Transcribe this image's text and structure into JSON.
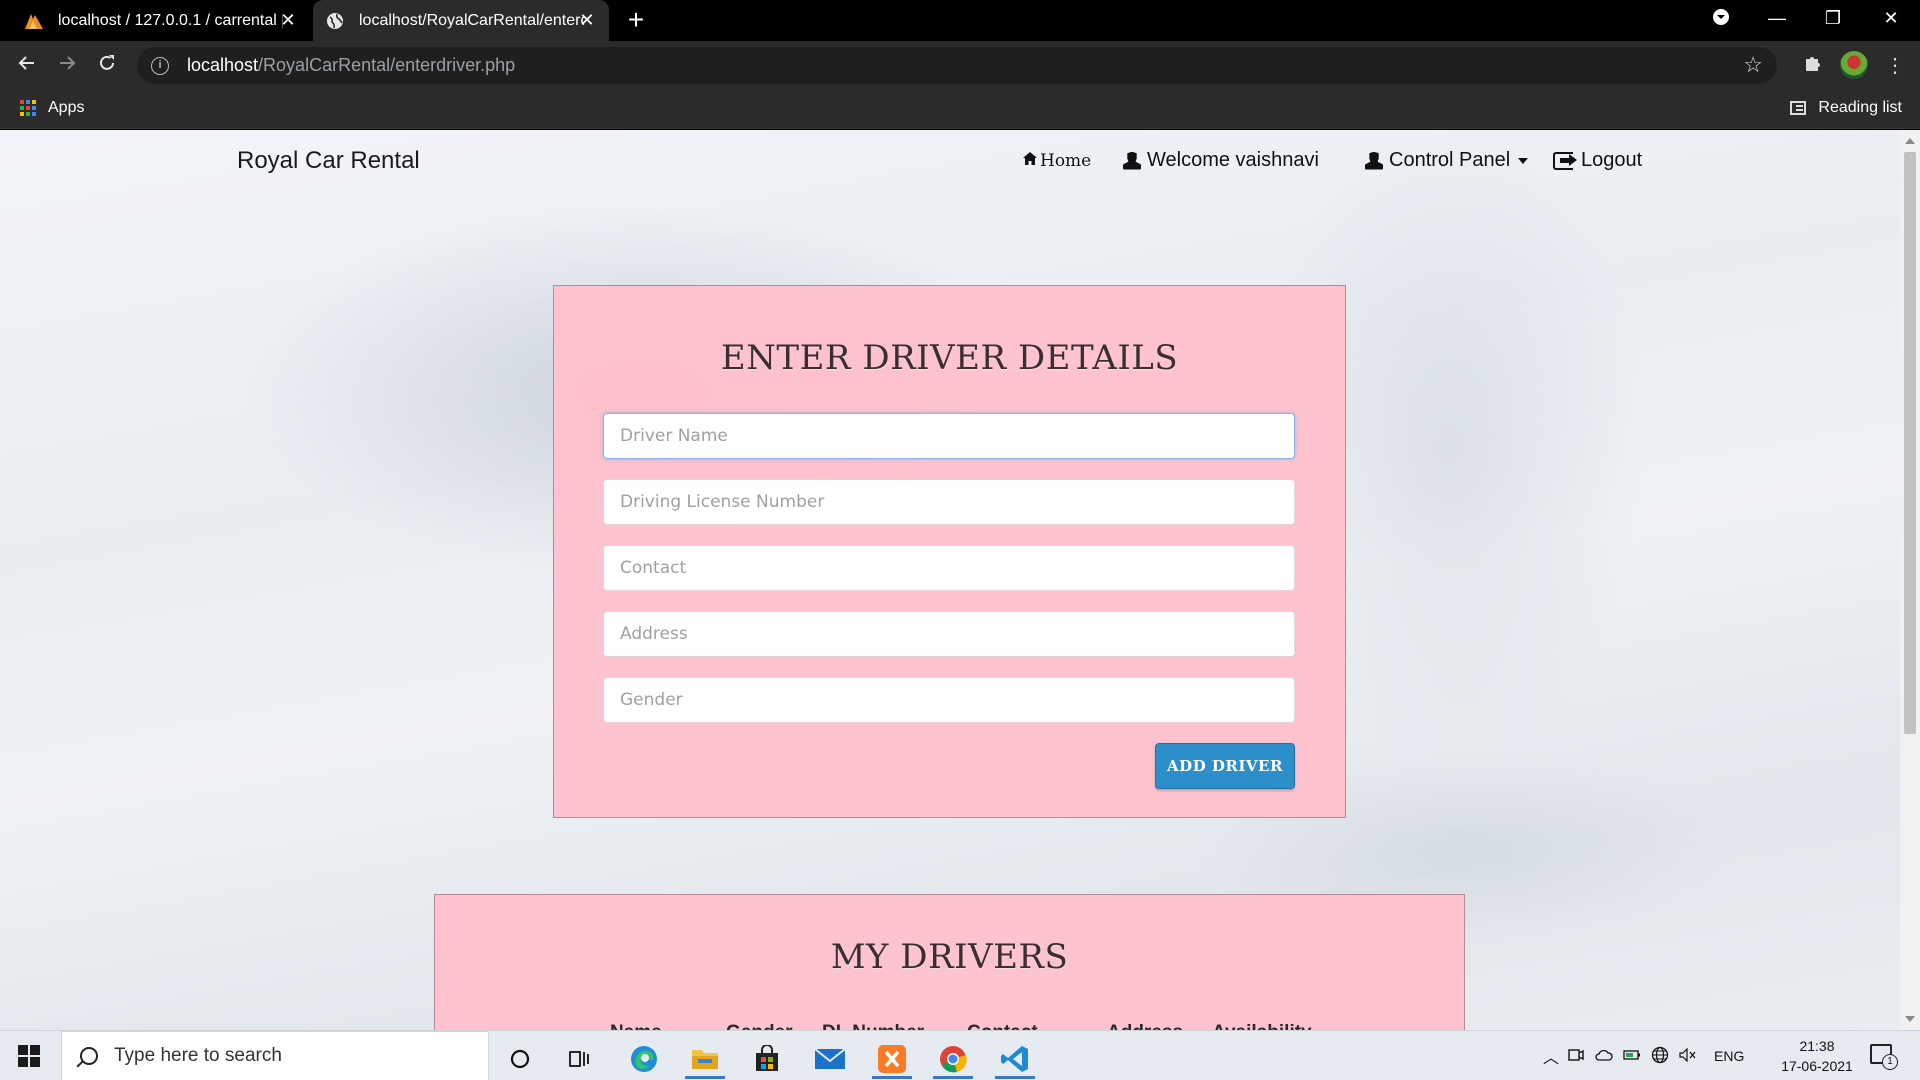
{
  "browser": {
    "tabs": [
      {
        "title": "localhost / 127.0.0.1 / carrental | ",
        "close": "✕"
      },
      {
        "title": "localhost/RoyalCarRental/enterdriver",
        "close": "✕"
      }
    ],
    "new_tab": "+",
    "window_controls": {
      "minimize": "—",
      "restore": "❐",
      "close": "✕"
    },
    "url_host": "localhost",
    "url_path": "/RoyalCarRental/enterdriver.php",
    "bookmarks": {
      "apps_label": "Apps",
      "reading_list_label": "Reading list"
    }
  },
  "page": {
    "brand": "Royal Car Rental",
    "nav": {
      "home": "Home",
      "welcome": "Welcome vaishnavi",
      "control_panel": "Control Panel",
      "logout": "Logout"
    },
    "form": {
      "title": "ENTER DRIVER DETAILS",
      "fields": [
        {
          "placeholder": "Driver Name",
          "value": ""
        },
        {
          "placeholder": "Driving License Number",
          "value": ""
        },
        {
          "placeholder": "Contact",
          "value": ""
        },
        {
          "placeholder": "Address",
          "value": ""
        },
        {
          "placeholder": "Gender",
          "value": ""
        }
      ],
      "submit_label": "ADD DRIVER"
    },
    "drivers": {
      "title": "MY DRIVERS",
      "columns": [
        "Name",
        "Gender",
        "DL Number",
        "Contact",
        "Address",
        "Availability"
      ]
    }
  },
  "taskbar": {
    "search_placeholder": "Type here to search",
    "language": "ENG",
    "time": "21:38",
    "date": "17-06-2021",
    "notification_count": "1"
  }
}
